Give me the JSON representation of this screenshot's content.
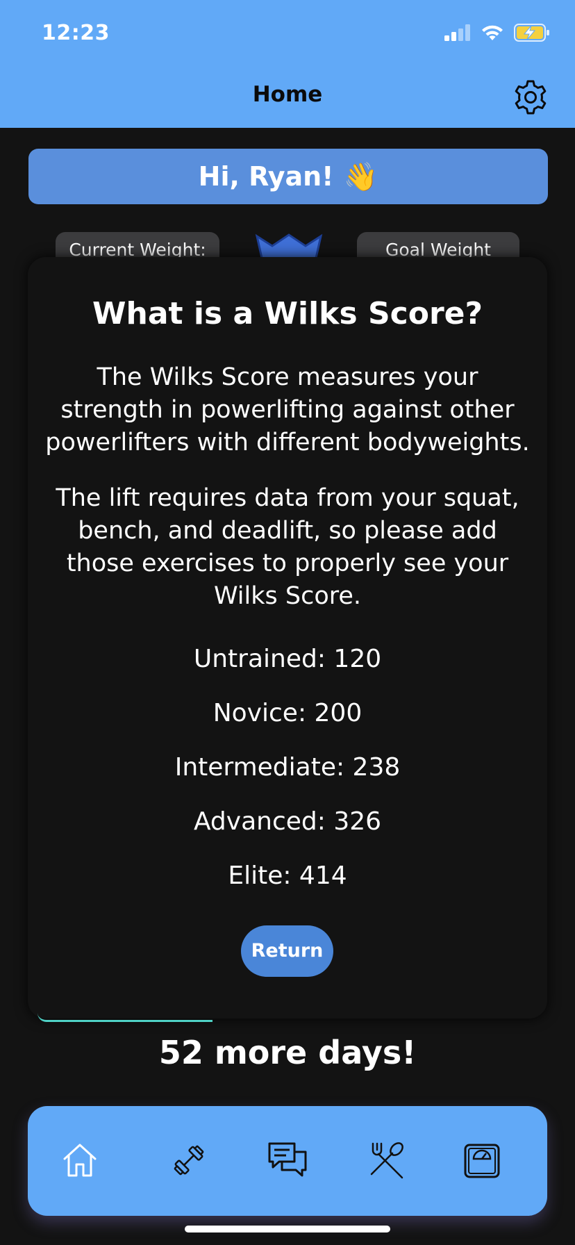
{
  "status_bar": {
    "time": "12:23",
    "icons": [
      "signal-icon",
      "wifi-icon",
      "battery-charging-icon"
    ],
    "battery_color": "#f4d03f"
  },
  "header": {
    "title": "Home",
    "settings_icon": "gear-icon"
  },
  "greeting": {
    "text": "Hi, Ryan!",
    "emoji": "👋"
  },
  "stats": {
    "current_weight_label": "Current Weight:",
    "goal_weight_label": "Goal Weight"
  },
  "wilks_modal": {
    "title": "What is a Wilks Score?",
    "paragraph_1": "The Wilks Score measures your strength in powerlifting against other powerlifters with different bodyweights.",
    "paragraph_2": "The lift requires data from your squat, bench, and deadlift, so please add those exercises to properly see your Wilks Score.",
    "levels": [
      "Untrained: 120",
      "Novice: 200",
      "Intermediate: 238",
      "Advanced: 326",
      "Elite: 414"
    ],
    "return_label": "Return"
  },
  "countdown": {
    "text": "52 more days!"
  },
  "tab_bar": {
    "tabs": [
      {
        "name": "home",
        "icon": "home-icon"
      },
      {
        "name": "workouts",
        "icon": "dumbbell-icon"
      },
      {
        "name": "chat",
        "icon": "chat-bubbles-icon"
      },
      {
        "name": "nutrition",
        "icon": "fork-spoon-icon"
      },
      {
        "name": "weight",
        "icon": "scale-icon"
      }
    ]
  },
  "colors": {
    "header_blue": "#61a9f7",
    "greeting_blue": "#5a8fdc",
    "button_blue": "#4a86d8",
    "background": "#131313",
    "progress_teal": "#4fd1c5"
  }
}
